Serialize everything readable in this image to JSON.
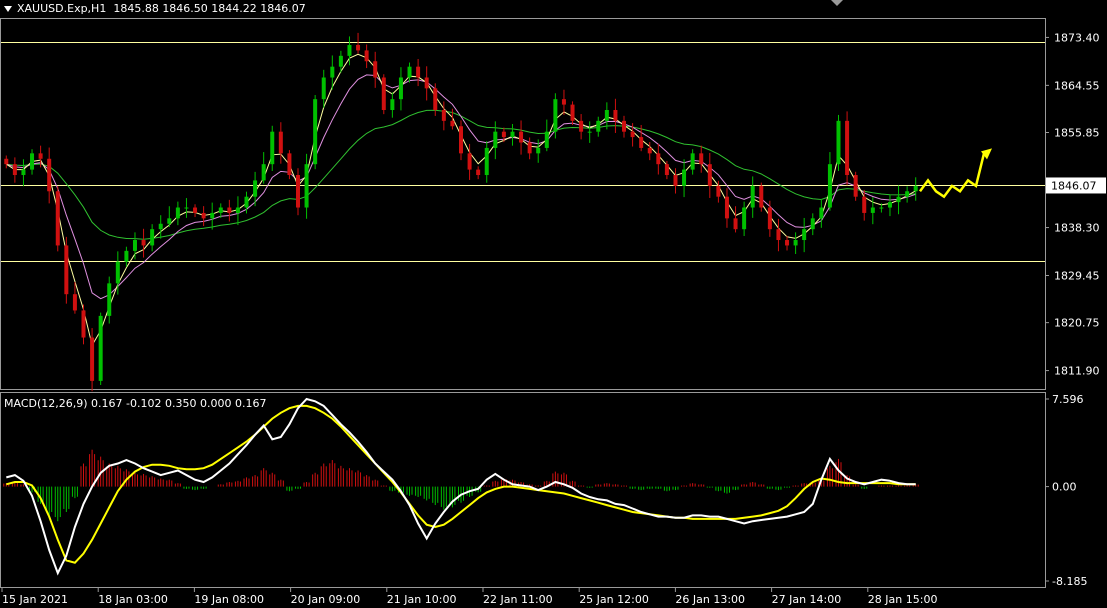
{
  "header": {
    "symbol": "XAUUSD.Exp,H1",
    "ohlc": "1845.88 1846.50 1844.22 1846.07"
  },
  "macd_header": "MACD(12,26,9) 0.167 -0.102 0.350 0.000 0.167",
  "colors": {
    "background": "#000000",
    "bull": "#00c000",
    "bear": "#d01010",
    "ma_fast": "#ffffa0",
    "ma_mid": "#e090e0",
    "ma_slow": "#30c030",
    "macd_line": "#ffffff",
    "signal_line": "#ffff00",
    "forecast": "#ffff00",
    "hline": "#ffffa0"
  },
  "chart_data": [
    {
      "type": "candlestick",
      "title": "XAUUSD.Exp,H1",
      "price_axis_ticks": [
        "1873.40",
        "1864.55",
        "1855.85",
        "1846.07",
        "1838.30",
        "1829.45",
        "1820.75",
        "1811.90"
      ],
      "ylim": [
        1808.5,
        1876.8
      ],
      "current_price": "1846.07",
      "horizontal_lines": [
        1872.6,
        1846.07,
        1832.1
      ],
      "time_axis_ticks": [
        "15 Jan 2021",
        "18 Jan 03:00",
        "19 Jan 08:00",
        "20 Jan 09:00",
        "21 Jan 10:00",
        "22 Jan 11:00",
        "25 Jan 12:00",
        "26 Jan 13:00",
        "27 Jan 14:00",
        "28 Jan 15:00"
      ],
      "close_path": [
        1850,
        1848,
        1849,
        1852,
        1851,
        1845,
        1835,
        1826,
        1823,
        1818,
        1810,
        1822,
        1828,
        1832,
        1834,
        1836,
        1835,
        1838,
        1839,
        1840,
        1842,
        1842,
        1841,
        1840,
        1841,
        1842,
        1841,
        1842,
        1844,
        1847,
        1850,
        1856,
        1852,
        1848,
        1842,
        1850,
        1862,
        1866,
        1868,
        1870,
        1872,
        1871,
        1869,
        1866,
        1860,
        1862,
        1866,
        1868,
        1866,
        1864,
        1860,
        1858,
        1857,
        1852,
        1849,
        1848,
        1853,
        1856,
        1855,
        1856,
        1854,
        1852,
        1853,
        1856,
        1862,
        1861,
        1858,
        1856,
        1856,
        1858,
        1860,
        1858,
        1856,
        1855,
        1853,
        1852,
        1850,
        1848,
        1846,
        1849,
        1852,
        1850,
        1846,
        1844,
        1840,
        1838,
        1842,
        1846,
        1842,
        1838,
        1836,
        1835,
        1836,
        1838,
        1840,
        1842,
        1850,
        1858,
        1848,
        1844,
        1841,
        1842,
        1842,
        1843,
        1844,
        1845,
        1846
      ],
      "forecast_path": [
        1845,
        1847,
        1845,
        1844,
        1846,
        1845,
        1847,
        1846,
        1852
      ]
    },
    {
      "type": "bar+line",
      "title": "MACD(12,26,9)",
      "axis_ticks": [
        "7.596",
        "0.00",
        "-8.185"
      ],
      "ylim": [
        -8.185,
        7.596
      ],
      "histogram": [
        0.3,
        0.4,
        0.2,
        -0.5,
        -1.5,
        -2.5,
        -3.0,
        -2.2,
        -1.0,
        2.0,
        3.2,
        2.6,
        2.0,
        1.8,
        1.5,
        1.2,
        1.1,
        0.9,
        0.7,
        0.6,
        0.3,
        -0.2,
        -0.3,
        -0.2,
        0.0,
        0.2,
        0.4,
        0.5,
        0.8,
        1.0,
        1.6,
        1.2,
        0.6,
        -0.4,
        -0.2,
        0.4,
        1.2,
        2.0,
        2.3,
        1.8,
        1.6,
        1.4,
        1.0,
        0.6,
        0.1,
        -0.4,
        -0.6,
        -0.8,
        -0.9,
        -1.2,
        -1.6,
        -2.0,
        -1.8,
        -1.4,
        -0.9,
        -0.5,
        0.1,
        0.5,
        0.7,
        0.6,
        0.4,
        0.2,
        0.1,
        0.5,
        1.3,
        1.2,
        0.5,
        0.1,
        -0.1,
        0.2,
        0.3,
        0.2,
        0.1,
        -0.2,
        -0.3,
        -0.2,
        -0.2,
        -0.4,
        -0.3,
        0.1,
        0.3,
        0.2,
        -0.1,
        -0.4,
        -0.6,
        -0.3,
        0.2,
        0.4,
        0.2,
        -0.2,
        -0.3,
        -0.1,
        0.1,
        0.3,
        0.4,
        0.6,
        1.8,
        2.4,
        1.0,
        0.2,
        -0.2,
        0.0,
        0.1,
        0.1,
        0.1,
        0.1,
        0.2
      ],
      "macd_line": [
        0.8,
        1.0,
        0.5,
        -0.8,
        -3.0,
        -5.5,
        -7.5,
        -6.0,
        -3.5,
        -1.5,
        0.0,
        1.2,
        1.8,
        2.0,
        2.3,
        2.0,
        1.6,
        1.3,
        1.0,
        1.2,
        1.4,
        1.0,
        0.6,
        0.4,
        0.8,
        1.4,
        2.0,
        2.8,
        3.6,
        4.5,
        5.3,
        4.1,
        4.3,
        5.4,
        6.8,
        7.6,
        7.4,
        7.0,
        6.2,
        5.4,
        4.7,
        3.9,
        3.0,
        2.0,
        1.3,
        0.6,
        -0.4,
        -1.6,
        -3.2,
        -4.5,
        -3.2,
        -2.2,
        -1.3,
        -0.7,
        -0.4,
        -0.2,
        0.6,
        1.1,
        0.6,
        0.2,
        0.1,
        0.0,
        -0.3,
        0.0,
        0.4,
        0.2,
        -0.1,
        -0.6,
        -0.9,
        -1.1,
        -1.2,
        -1.5,
        -1.6,
        -1.9,
        -2.2,
        -2.4,
        -2.6,
        -2.6,
        -2.7,
        -2.7,
        -2.5,
        -2.5,
        -2.6,
        -2.6,
        -2.8,
        -3.0,
        -3.2,
        -3.0,
        -2.9,
        -2.8,
        -2.7,
        -2.6,
        -2.4,
        -2.2,
        -1.5,
        0.6,
        2.4,
        1.4,
        0.7,
        0.4,
        0.2,
        0.4,
        0.6,
        0.5,
        0.3,
        0.2,
        0.2
      ],
      "signal_line": [
        0.2,
        0.4,
        0.4,
        0.1,
        -1.0,
        -2.6,
        -4.6,
        -6.4,
        -6.6,
        -5.8,
        -4.6,
        -3.2,
        -1.8,
        -0.4,
        0.6,
        1.3,
        1.7,
        1.9,
        1.9,
        1.8,
        1.6,
        1.5,
        1.5,
        1.6,
        1.9,
        2.4,
        2.9,
        3.4,
        3.9,
        4.5,
        5.2,
        5.9,
        6.4,
        6.8,
        7.0,
        7.0,
        6.8,
        6.4,
        5.9,
        5.2,
        4.4,
        3.6,
        2.8,
        2.0,
        1.2,
        0.4,
        -0.5,
        -1.5,
        -2.5,
        -3.3,
        -3.5,
        -3.3,
        -2.8,
        -2.2,
        -1.6,
        -1.0,
        -0.5,
        -0.2,
        0.0,
        0.0,
        -0.1,
        -0.2,
        -0.3,
        -0.4,
        -0.5,
        -0.6,
        -0.8,
        -1.0,
        -1.2,
        -1.4,
        -1.6,
        -1.8,
        -2.0,
        -2.2,
        -2.3,
        -2.4,
        -2.5,
        -2.6,
        -2.7,
        -2.7,
        -2.8,
        -2.8,
        -2.8,
        -2.8,
        -2.8,
        -2.8,
        -2.7,
        -2.6,
        -2.5,
        -2.3,
        -2.1,
        -1.7,
        -1.0,
        -0.2,
        0.4,
        0.7,
        0.6,
        0.4,
        0.3,
        0.3,
        0.3,
        0.3,
        0.3,
        0.3,
        0.2,
        0.2,
        0.2
      ]
    }
  ]
}
